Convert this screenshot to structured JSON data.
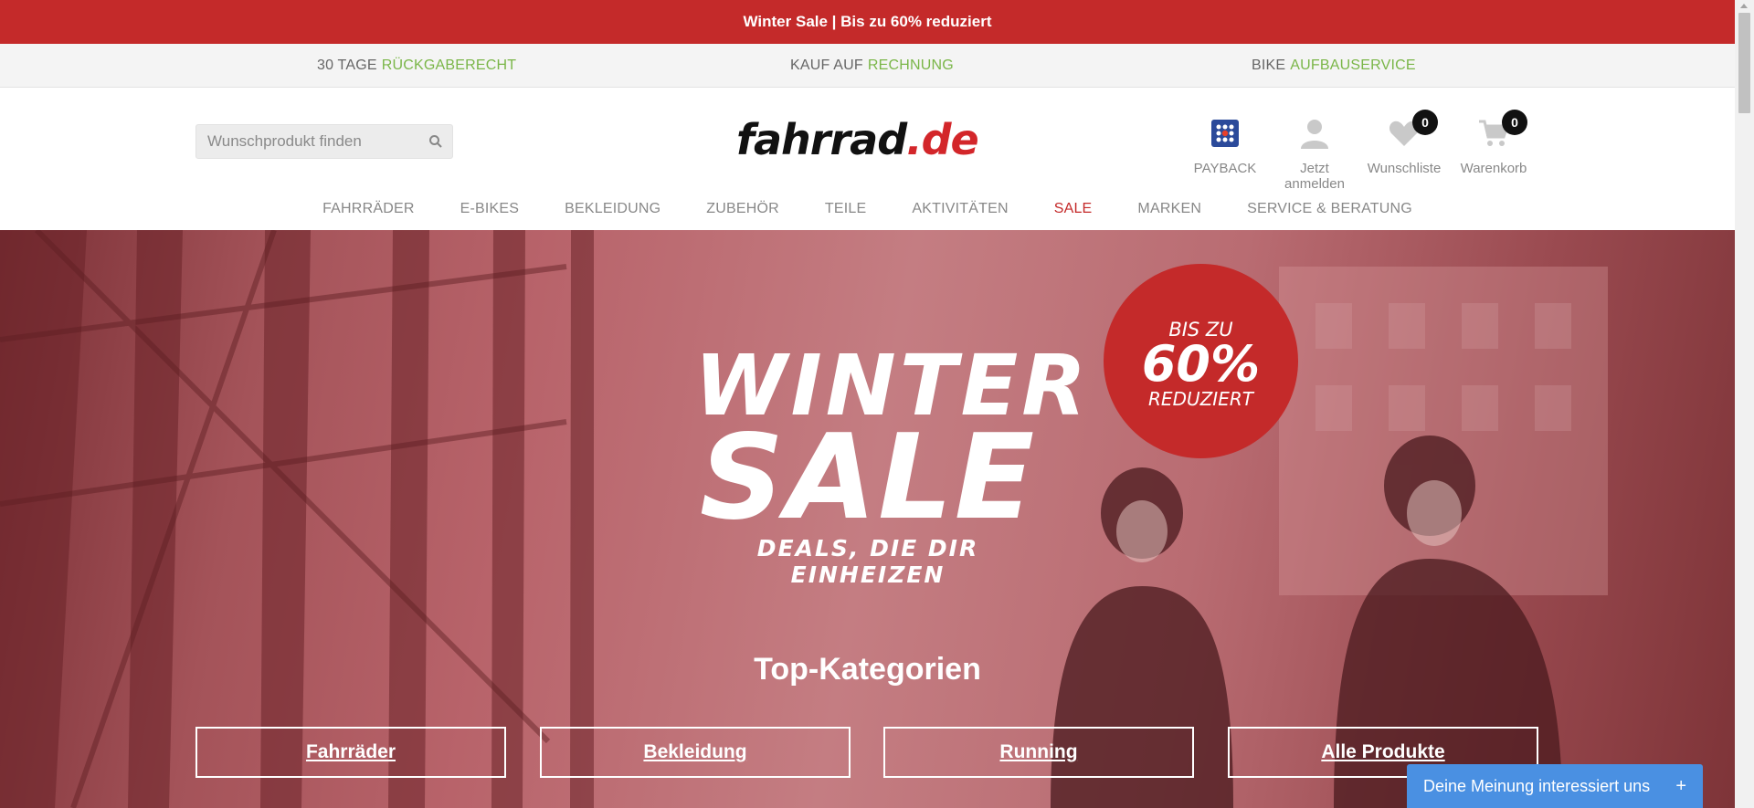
{
  "promo_bar": {
    "text": "Winter Sale | Bis zu 60% reduziert"
  },
  "usps": [
    {
      "prefix": "30 TAGE",
      "highlight": "RÜCKGABERECHT"
    },
    {
      "prefix": "KAUF AUF",
      "highlight": "RECHNUNG"
    },
    {
      "prefix": "BIKE",
      "highlight": "AUFBAUSERVICE"
    }
  ],
  "search": {
    "placeholder": "Wunschprodukt finden",
    "icon": "search-icon"
  },
  "logo": {
    "name": "fahrrad",
    "tld": ".de"
  },
  "header_actions": [
    {
      "label": "PAYBACK",
      "icon": "payback-icon"
    },
    {
      "label": "Jetzt anmelden",
      "icon": "user-icon"
    },
    {
      "label": "Wunschliste",
      "icon": "heart-icon",
      "count": "0"
    },
    {
      "label": "Warenkorb",
      "icon": "cart-icon",
      "count": "0"
    }
  ],
  "nav": [
    "FAHRRÄDER",
    "E-BIKES",
    "BEKLEIDUNG",
    "ZUBEHÖR",
    "TEILE",
    "AKTIVITÄTEN",
    "SALE",
    "MARKEN",
    "SERVICE & BERATUNG"
  ],
  "hero": {
    "line1": "WINTER",
    "line2": "SALE",
    "line3": "DEALS, DIE DIR EINHEIZEN",
    "badge": {
      "top": "BIS ZU",
      "value": "60%",
      "bottom": "REDUZIERT"
    }
  },
  "top_categories": {
    "title": "Top-Kategorien",
    "items": [
      "Fahrräder",
      "Bekleidung",
      "Running",
      "Alle Produkte"
    ]
  },
  "feedback": {
    "label": "Deine Meinung interessiert uns",
    "plus": "+"
  },
  "colors": {
    "brand_red": "#c42a2a",
    "accent_green": "#7ab648",
    "feedback_blue": "#4a90e2"
  }
}
